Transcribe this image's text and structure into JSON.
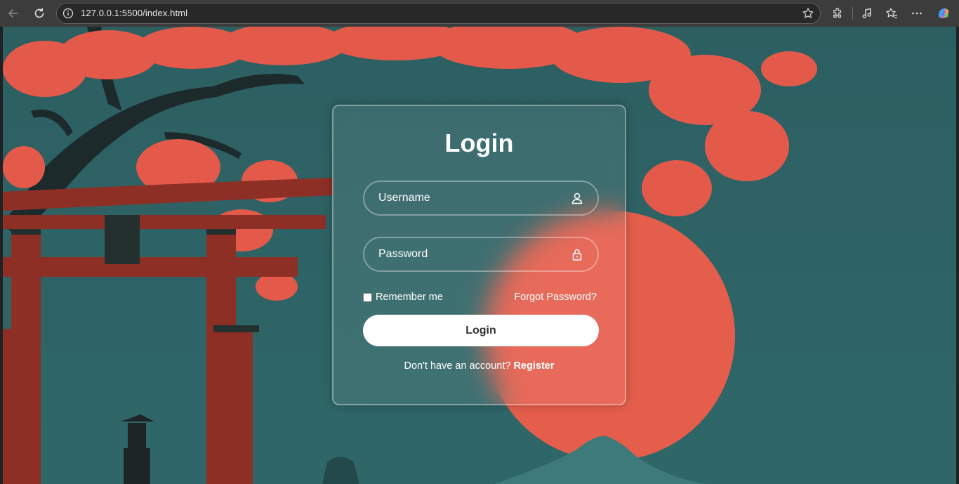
{
  "browser": {
    "url": "127.0.0.1:5500/index.html",
    "icons": [
      "back-arrow-icon",
      "refresh-icon",
      "site-info-icon",
      "bookmark-star-icon",
      "extensions-icon",
      "media-icon",
      "favorites-icon",
      "more-icon",
      "copilot-icon"
    ]
  },
  "login": {
    "title": "Login",
    "username_placeholder": "Username",
    "password_placeholder": "Password",
    "remember_label": "Remember me",
    "remember_checked": false,
    "forgot_label": "Forgot Password?",
    "submit_label": "Login",
    "register_prompt": "Don't have an account?",
    "register_link": "Register"
  },
  "colors": {
    "background_teal": "#2f6466",
    "sun": "#e55e4c",
    "blossom": "#e35a4b",
    "torii": "#8e2f26",
    "card_text": "#ffffff",
    "button_bg": "#ffffff",
    "button_text": "#333333"
  }
}
